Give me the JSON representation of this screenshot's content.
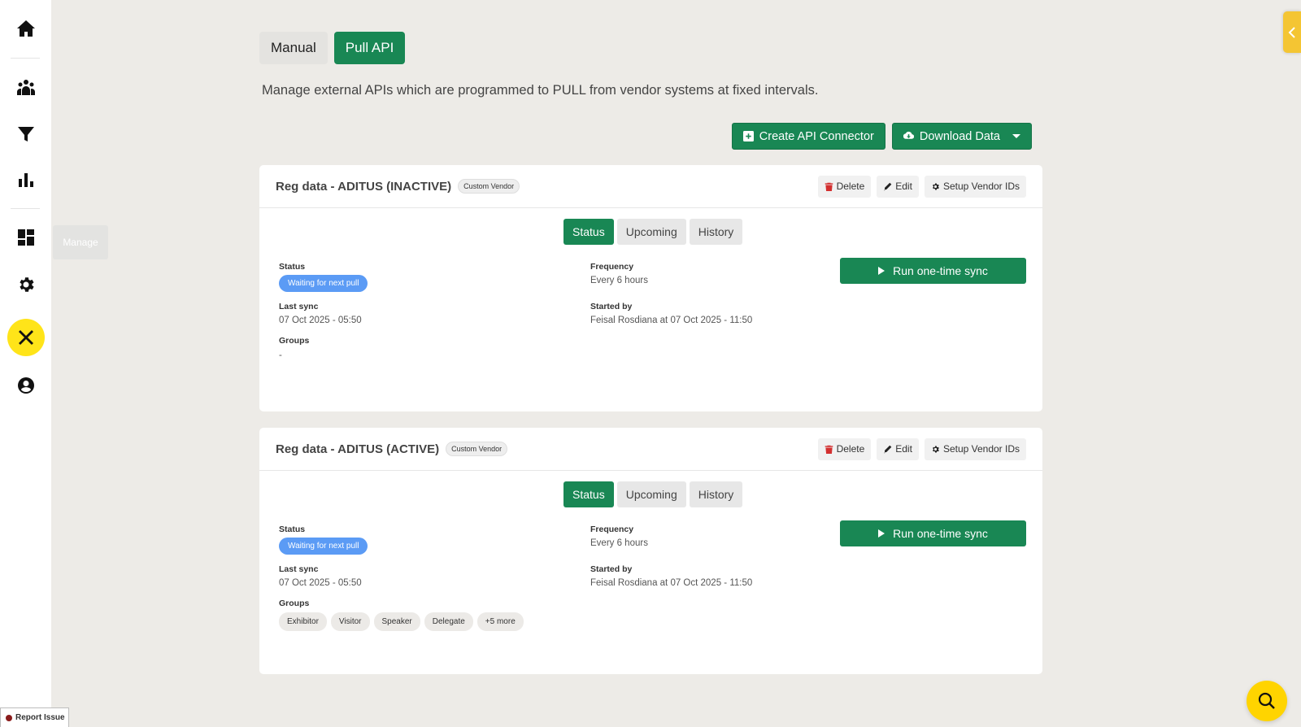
{
  "sidebar": {
    "tooltip": "Manage",
    "items": [
      {
        "icon": "home-icon"
      },
      {
        "icon": "people-icon"
      },
      {
        "icon": "filter-icon"
      },
      {
        "icon": "bar-chart-icon"
      },
      {
        "icon": "dashboard-icon"
      },
      {
        "icon": "gear-icon"
      },
      {
        "icon": "tools-icon"
      },
      {
        "icon": "user-circle-icon"
      }
    ]
  },
  "report_issue": {
    "label": "Report Issue"
  },
  "mode_tabs": [
    {
      "label": "Manual"
    },
    {
      "label": "Pull API"
    }
  ],
  "description": "Manage external APIs which are programmed to PULL from vendor systems at fixed intervals.",
  "actions": {
    "create": "Create API Connector",
    "download": "Download Data"
  },
  "cards": [
    {
      "title": "Reg data - ADITUS (INACTIVE)",
      "badge": "Custom Vendor",
      "buttons": {
        "delete": "Delete",
        "edit": "Edit",
        "setup": "Setup Vendor IDs"
      },
      "tabs": [
        "Status",
        "Upcoming",
        "History"
      ],
      "status_label": "Status",
      "status": "Waiting for next pull",
      "last_sync_label": "Last sync",
      "last_sync": "07 Oct 2025 - 05:50",
      "groups_label": "Groups",
      "groups_empty": "-",
      "frequency_label": "Frequency",
      "frequency": "Every 6 hours",
      "started_by_label": "Started by",
      "started_by": "Feisal Rosdiana at 07 Oct 2025 - 11:50",
      "run_label": "Run one-time sync"
    },
    {
      "title": "Reg data - ADITUS (ACTIVE)",
      "badge": "Custom Vendor",
      "buttons": {
        "delete": "Delete",
        "edit": "Edit",
        "setup": "Setup Vendor IDs"
      },
      "tabs": [
        "Status",
        "Upcoming",
        "History"
      ],
      "status_label": "Status",
      "status": "Waiting for next pull",
      "last_sync_label": "Last sync",
      "last_sync": "07 Oct 2025 - 05:50",
      "groups_label": "Groups",
      "groups": [
        "Exhibitor",
        "Visitor",
        "Speaker",
        "Delegate",
        "+5 more"
      ],
      "frequency_label": "Frequency",
      "frequency": "Every 6 hours",
      "started_by_label": "Started by",
      "started_by": "Feisal Rosdiana at 07 Oct 2025 - 11:50",
      "run_label": "Run one-time sync"
    }
  ],
  "colors": {
    "primary": "#198754",
    "accent": "#ffe419",
    "status_pill": "#5b9bf5"
  }
}
